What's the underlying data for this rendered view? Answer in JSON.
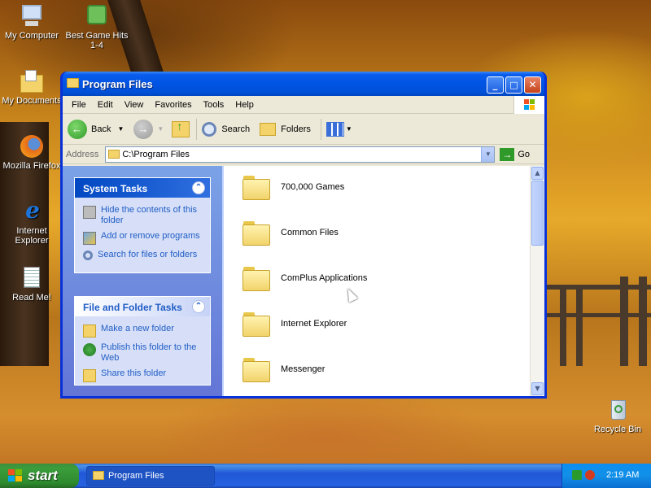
{
  "desktop": {
    "icons": [
      {
        "label": "My Computer",
        "icon": "computer-icon"
      },
      {
        "label": "Best Game Hits 1-4",
        "icon": "game-dice-icon"
      },
      {
        "label": "My Documents",
        "icon": "documents-folder-icon"
      },
      {
        "label": "Mozilla Firefox",
        "icon": "firefox-icon"
      },
      {
        "label": "Internet Explorer",
        "icon": "internet-explorer-icon"
      },
      {
        "label": "Read Me!",
        "icon": "notepad-icon"
      },
      {
        "label": "Recycle Bin",
        "icon": "recycle-bin-icon"
      }
    ]
  },
  "window": {
    "title": "Program Files",
    "controls": {
      "minimize": "_",
      "maximize": "□",
      "close": "✕"
    },
    "menu": [
      "File",
      "Edit",
      "View",
      "Favorites",
      "Tools",
      "Help"
    ],
    "toolbar": {
      "back": "Back",
      "search": "Search",
      "folders": "Folders"
    },
    "address": {
      "label": "Address",
      "value": "C:\\Program Files",
      "go": "Go"
    },
    "system_tasks": {
      "title": "System Tasks",
      "items": [
        "Hide the contents of this folder",
        "Add or remove programs",
        "Search for files or folders"
      ]
    },
    "file_folder_tasks": {
      "title": "File and Folder Tasks",
      "items": [
        "Make a new folder",
        "Publish this folder to the Web",
        "Share this folder"
      ]
    },
    "folders": [
      "700,000 Games",
      "Common Files",
      "ComPlus Applications",
      "Internet Explorer",
      "Messenger"
    ]
  },
  "taskbar": {
    "start": "start",
    "task": "Program Files",
    "clock": "2:19 AM"
  },
  "colors": {
    "title_blue": "#0054e3",
    "task_link": "#215dc6",
    "start_green": "#3b9d3b"
  }
}
